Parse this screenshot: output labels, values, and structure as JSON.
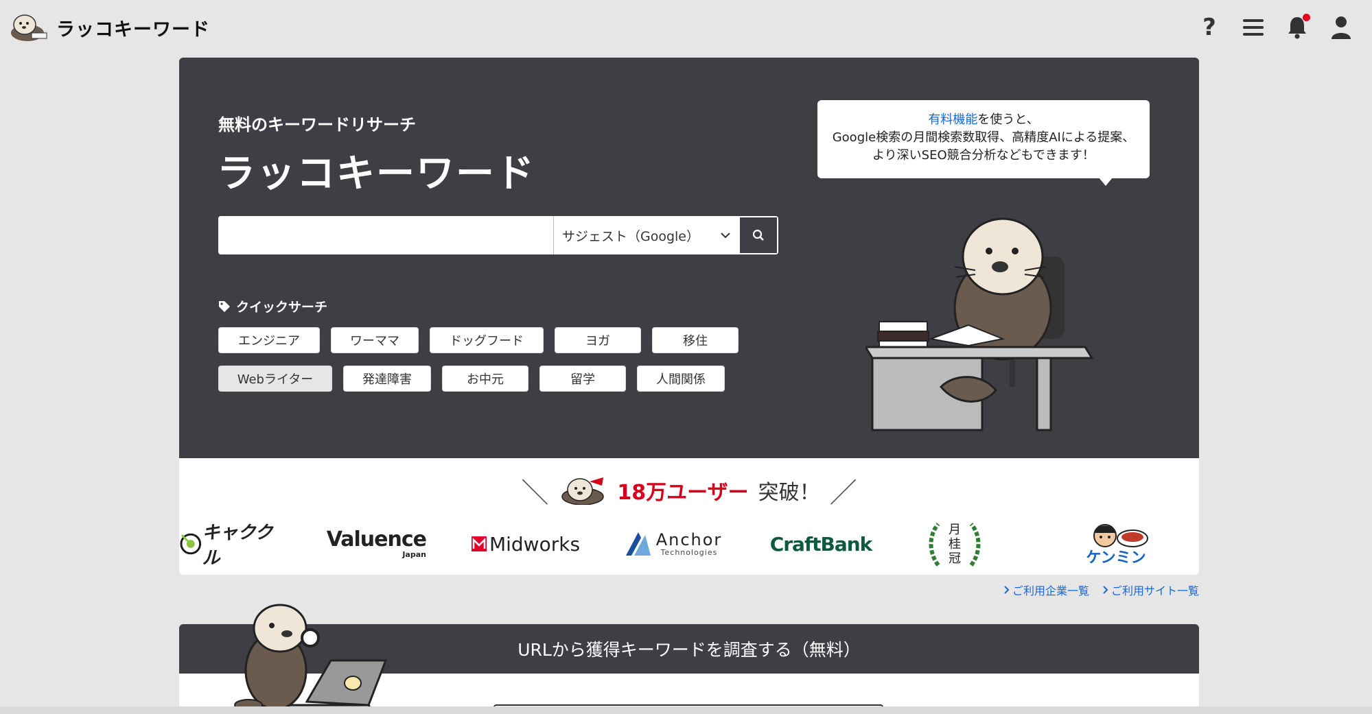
{
  "header": {
    "logo_text": "ラッコキーワード",
    "icons": [
      "help-icon",
      "menu-icon",
      "bell-icon",
      "user-icon"
    ],
    "help_glyph": "?"
  },
  "hero": {
    "subtitle": "無料のキーワードリサーチ",
    "title": "ラッコキーワード",
    "search": {
      "value": "",
      "placeholder": "",
      "mode_selected": "サジェスト（Google）"
    },
    "quick_search_label": "クイックサーチ",
    "quick_row1": [
      "エンジニア",
      "ワーママ",
      "ドッグフード",
      "ヨガ",
      "移住"
    ],
    "quick_row2": [
      "Webライター",
      "発達障害",
      "お中元",
      "留学",
      "人間関係"
    ],
    "bubble": {
      "link": "有料機能",
      "line1_rest": "を使うと、",
      "line2": "Google検索の月間検索数取得、高精度AIによる提案、",
      "line3": "より深いSEO競合分析などもできます！"
    }
  },
  "milestone": {
    "left_slash": "＼",
    "highlight": "18万ユーザー",
    "rest": "突破！",
    "right_slash": "／"
  },
  "company_logos": {
    "kyakukuru": "キャククル",
    "valuence": "Valuence",
    "valuence_sub": "Japan",
    "midworks": "Midworks",
    "anchor": "Anchor",
    "anchor_sub": "Technologies",
    "craftbank": "CraftBank",
    "gekkeikan": "月桂冠",
    "kenmin": "ケンミン"
  },
  "util_links": {
    "companies": "ご利用企業一覧",
    "sites": "ご利用サイト一覧"
  },
  "url_section": {
    "title": "URLから獲得キーワードを調査する（無料）"
  },
  "colors": {
    "hero_bg": "#3e3e45",
    "accent_red": "#d6001c",
    "link_blue": "#1668d6",
    "page_bg": "#e6e6e6"
  }
}
